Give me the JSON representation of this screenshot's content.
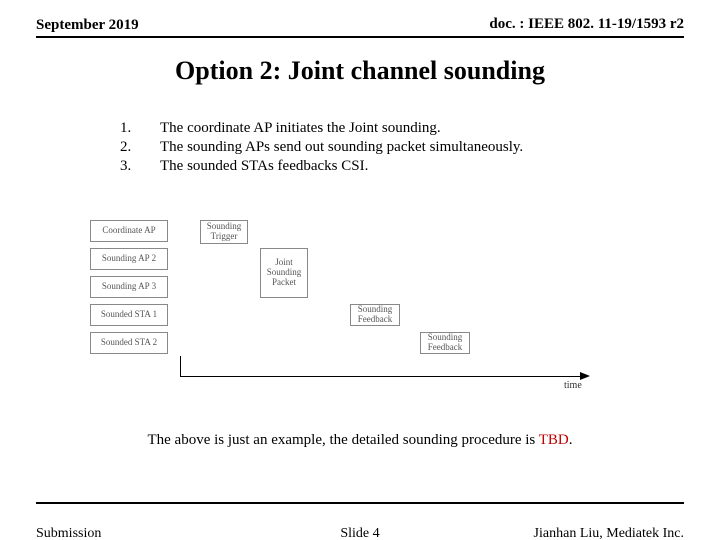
{
  "header": {
    "date": "September 2019",
    "doc_label": "doc. : IEEE 802. 11-19/1593 r2"
  },
  "title": "Option 2: Joint channel sounding",
  "list": [
    {
      "num": "1.",
      "text": "The coordinate AP initiates the Joint sounding."
    },
    {
      "num": "2.",
      "text": "The sounding APs send out sounding packet simultaneously."
    },
    {
      "num": "3.",
      "text": "The sounded STAs feedbacks CSI."
    }
  ],
  "diagram": {
    "rows": [
      "Coordinate AP",
      "Sounding AP 2",
      "Sounding AP 3",
      "Sounded STA 1",
      "Sounded STA 2"
    ],
    "boxes": {
      "trigger": "Sounding Trigger",
      "joint": "Joint Sounding Packet",
      "feedback1": "Sounding Feedback",
      "feedback2": "Sounding Feedback"
    },
    "axis_label": "time"
  },
  "caption_prefix": "The above is just an example, the detailed sounding procedure is ",
  "caption_tbd": "TBD",
  "caption_suffix": ".",
  "footer": {
    "left": "Submission",
    "center": "Slide 4",
    "right": "Jianhan Liu, Mediatek Inc."
  }
}
